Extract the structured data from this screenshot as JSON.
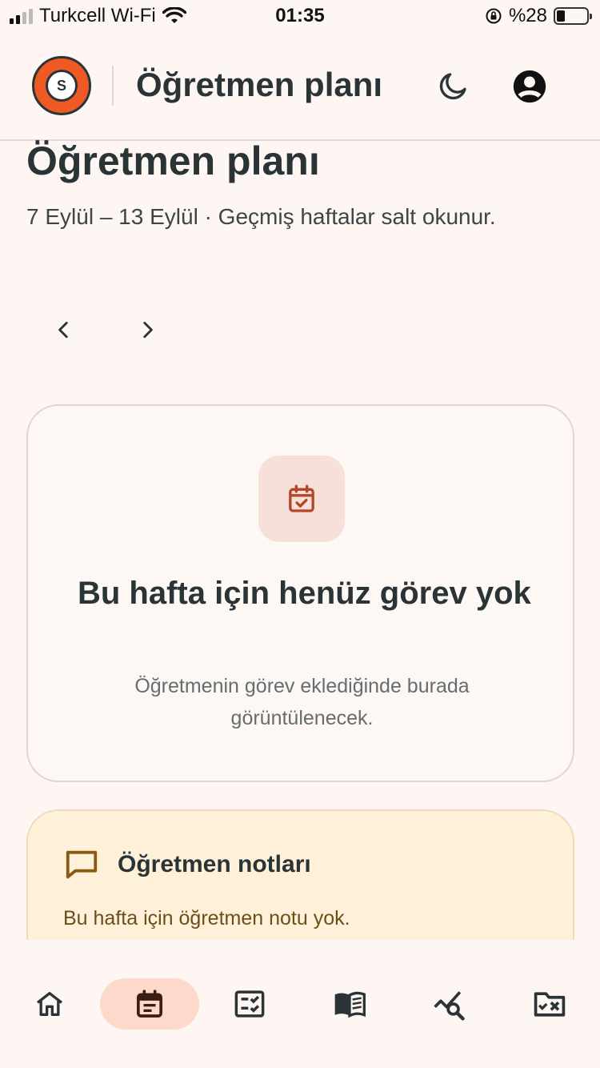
{
  "status_bar": {
    "carrier": "Turkcell Wi-Fi",
    "time": "01:35",
    "battery_text": "%28",
    "battery_level": 0.28
  },
  "header": {
    "logo_text": "S",
    "title": "Öğretmen planı",
    "icons": [
      "moon-icon",
      "account-circle-icon"
    ]
  },
  "page": {
    "title": "Öğretmen planı",
    "subtitle": "7 Eylül – 13 Eylül · Geçmiş haftalar salt okunur.",
    "nav_icons": [
      "chevron-left-icon",
      "chevron-right-icon"
    ]
  },
  "empty_state": {
    "icon": "calendar-check-icon",
    "title": "Bu hafta için henüz görev yok",
    "description": "Öğretmenin görev eklediğinde burada görüntülenecek."
  },
  "notes": {
    "icon": "comment-icon",
    "title": "Öğretmen notları",
    "text": "Bu hafta için öğretmen notu yok."
  },
  "bottom_nav": {
    "items": [
      {
        "icon": "home-icon",
        "active": false
      },
      {
        "icon": "calendar-icon",
        "active": true
      },
      {
        "icon": "checklist-icon",
        "active": false
      },
      {
        "icon": "book-icon",
        "active": false
      },
      {
        "icon": "analytics-search-icon",
        "active": false
      },
      {
        "icon": "folder-close-icon",
        "active": false
      }
    ]
  },
  "colors": {
    "background": "#fdf6f2",
    "primary_text": "#2a3437",
    "accent": "#b5462a",
    "active_pill": "#fdd9cc",
    "notes_bg": "#fff1d9",
    "notes_accent": "#8a5a12",
    "logo_orange": "#ef5a24"
  }
}
